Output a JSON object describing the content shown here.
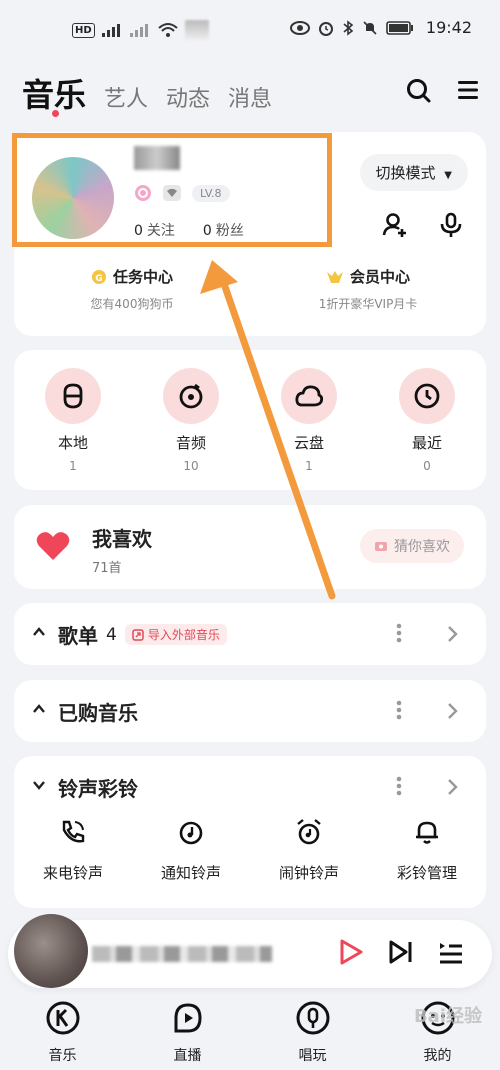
{
  "status_bar": {
    "hd_label": "HD",
    "time": "19:42"
  },
  "top_tabs": [
    {
      "label": "音乐",
      "active": true
    },
    {
      "label": "艺人",
      "active": false
    },
    {
      "label": "动态",
      "active": false
    },
    {
      "label": "消息",
      "active": false
    }
  ],
  "user": {
    "level": "LV.8",
    "follow_count": "0",
    "follow_label": "关注",
    "fans_count": "0",
    "fans_label": "粉丝",
    "mode_button": "切换模式"
  },
  "tasks": [
    {
      "title": "任务中心",
      "subtitle": "您有400狗狗币",
      "icon": "coin-icon"
    },
    {
      "title": "会员中心",
      "subtitle": "1折开豪华VIP月卡",
      "icon": "vip-icon"
    }
  ],
  "library": [
    {
      "label": "本地",
      "count": "1",
      "icon": "local-music-icon"
    },
    {
      "label": "音频",
      "count": "10",
      "icon": "audio-icon"
    },
    {
      "label": "云盘",
      "count": "1",
      "icon": "cloud-icon"
    },
    {
      "label": "最近",
      "count": "0",
      "icon": "clock-icon"
    }
  ],
  "favorites": {
    "title": "我喜欢",
    "count": "71首",
    "guess_button": "猜你喜欢"
  },
  "playlists": {
    "title": "歌单",
    "count": "4",
    "import_tag": "导入外部音乐"
  },
  "purchased": {
    "title": "已购音乐"
  },
  "ringtones": {
    "title": "铃声彩铃",
    "items": [
      {
        "label": "来电铃声",
        "icon": "phone-ring-icon"
      },
      {
        "label": "通知铃声",
        "icon": "notification-icon"
      },
      {
        "label": "闹钟铃声",
        "icon": "alarm-icon"
      },
      {
        "label": "彩铃管理",
        "icon": "bell-manage-icon"
      }
    ]
  },
  "bottom_nav": [
    {
      "label": "音乐",
      "icon": "music-k-icon"
    },
    {
      "label": "直播",
      "icon": "live-icon"
    },
    {
      "label": "唱玩",
      "icon": "mic-icon"
    },
    {
      "label": "我的",
      "icon": "profile-icon"
    }
  ],
  "watermark": "Bai经验",
  "colors": {
    "accent": "#f0465a",
    "highlight_box": "#f39a3d",
    "icon_bg": "#fbdcdc"
  }
}
